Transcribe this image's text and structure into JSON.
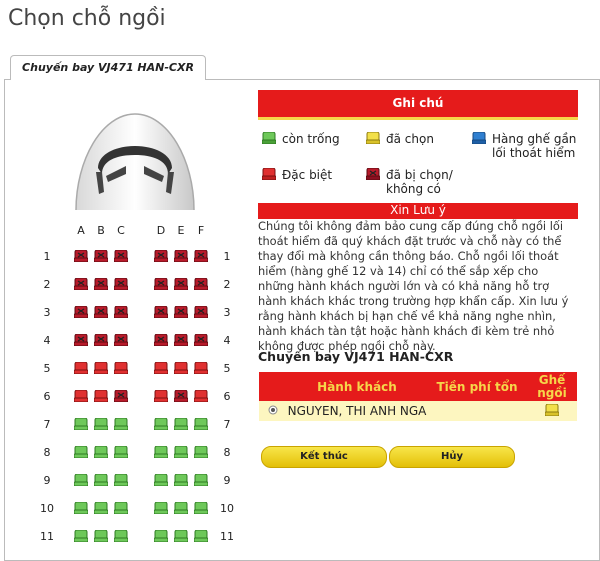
{
  "page": {
    "title": "Chọn chỗ ngồi"
  },
  "tab": {
    "label": "Chuyến bay VJ471 HAN-CXR"
  },
  "seat_map": {
    "columns_left": [
      "A",
      "B",
      "C"
    ],
    "columns_right": [
      "D",
      "E",
      "F"
    ],
    "rows": [
      {
        "n": "1",
        "left": [
          "taken",
          "taken",
          "taken"
        ],
        "right": [
          "taken",
          "taken",
          "taken"
        ]
      },
      {
        "n": "2",
        "left": [
          "taken",
          "taken",
          "taken"
        ],
        "right": [
          "taken",
          "taken",
          "taken"
        ]
      },
      {
        "n": "3",
        "left": [
          "taken",
          "taken",
          "taken"
        ],
        "right": [
          "taken",
          "taken",
          "taken"
        ]
      },
      {
        "n": "4",
        "left": [
          "taken",
          "taken",
          "taken"
        ],
        "right": [
          "taken",
          "taken",
          "taken"
        ]
      },
      {
        "n": "5",
        "left": [
          "special",
          "special",
          "special"
        ],
        "right": [
          "special",
          "special",
          "special"
        ]
      },
      {
        "n": "6",
        "left": [
          "special",
          "special",
          "taken"
        ],
        "right": [
          "special",
          "taken",
          "special"
        ]
      },
      {
        "n": "7",
        "left": [
          "available",
          "available",
          "available"
        ],
        "right": [
          "available",
          "available",
          "available"
        ]
      },
      {
        "n": "8",
        "left": [
          "available",
          "available",
          "available"
        ],
        "right": [
          "available",
          "available",
          "available"
        ]
      },
      {
        "n": "9",
        "left": [
          "available",
          "available",
          "available"
        ],
        "right": [
          "available",
          "available",
          "available"
        ]
      },
      {
        "n": "10",
        "left": [
          "available",
          "available",
          "available"
        ],
        "right": [
          "available",
          "available",
          "available"
        ]
      },
      {
        "n": "11",
        "left": [
          "available",
          "available",
          "available"
        ],
        "right": [
          "available",
          "available",
          "available"
        ]
      }
    ]
  },
  "seat_colors": {
    "available": "#6ec85a",
    "special": "#e03030",
    "taken": "#b81a2a",
    "selected": "#f2e04a",
    "exit": "#2f7fd0"
  },
  "notes": {
    "header": "Ghi chú",
    "legend": {
      "available": "còn trống",
      "selected": "đã chọn",
      "exit_line1": "Hàng ghế gần",
      "exit_line2": "lối thoát hiểm",
      "special": "Đặc biệt",
      "taken_line1": "đã bị chọn/",
      "taken_line2": "không có"
    }
  },
  "caution": {
    "header": "Xin Lưu ý",
    "lines": [
      "Chúng tôi không đảm bảo cung cấp đúng chỗ ngồi lối",
      "thoát hiểm đã quý khách đặt trước và chỗ này có thể",
      "thay đổi mà không cần thông báo. Chỗ ngồi lối thoát",
      "hiểm (hàng ghế 12 và 14) chỉ có thể sắp xếp cho",
      "những hành khách người lớn và có khả năng hỗ trợ",
      "hành khách khác trong trường hợp khẩn cấp. Xin lưu ý",
      "rằng hành khách bị hạn chế về khả năng nghe nhìn,",
      "hành khách tàn tật hoặc hành khách đi kèm trẻ nhỏ",
      "không được phép ngồi chỗ này."
    ]
  },
  "flight": {
    "title": "Chuyến bay VJ471 HAN-CXR"
  },
  "passengers": {
    "headers": {
      "name": "Hành khách",
      "fee": "Tiền phí tổn",
      "seat_line1": "Ghế",
      "seat_line2": "ngồi"
    },
    "rows": [
      {
        "name": "NGUYEN, THI ANH NGA",
        "fee": ""
      }
    ]
  },
  "buttons": {
    "finish": "Kết thúc",
    "cancel": "Hủy"
  }
}
